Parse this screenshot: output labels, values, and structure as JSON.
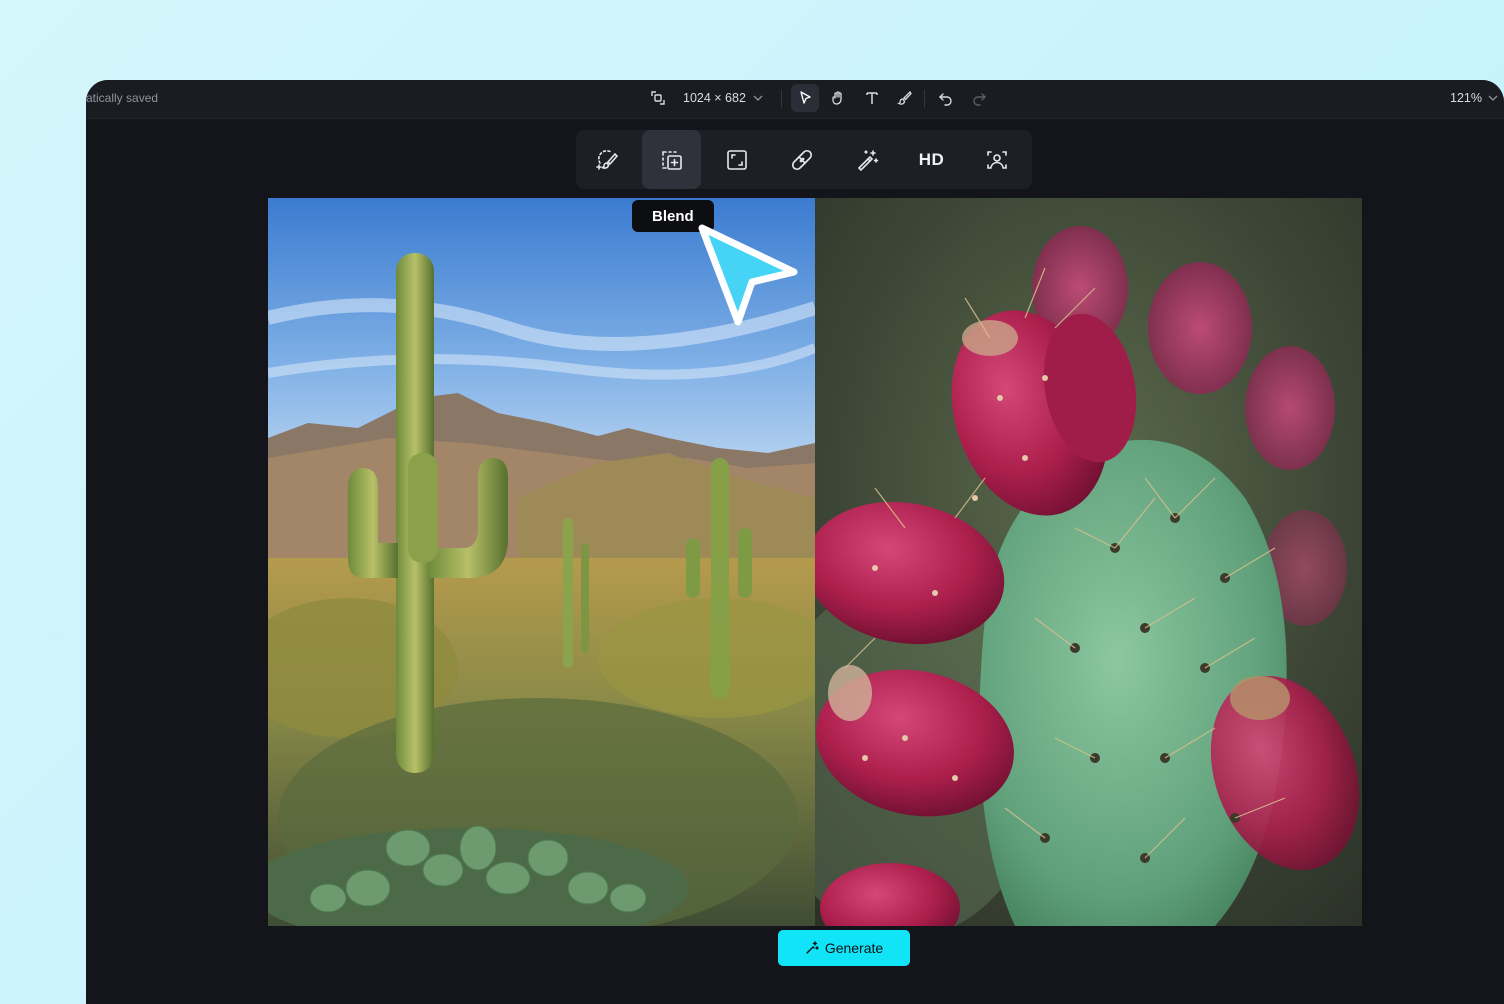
{
  "topbar": {
    "save_status": "atically saved",
    "canvas_size": "1024 × 682",
    "zoom": "121%",
    "icons": [
      "resize-icon",
      "select-arrow-icon",
      "hand-icon",
      "text-icon",
      "brush-icon",
      "undo-icon",
      "redo-icon"
    ]
  },
  "tools": {
    "items": [
      {
        "name": "selection-brush-icon"
      },
      {
        "name": "blend-icon",
        "active": true
      },
      {
        "name": "expand-icon"
      },
      {
        "name": "bandage-icon"
      },
      {
        "name": "magic-wand-icon"
      },
      {
        "name": "hd",
        "label": "HD"
      },
      {
        "name": "portrait-icon"
      }
    ],
    "tooltip": "Blend"
  },
  "images": {
    "left": "saguaro-desert-landscape",
    "right": "prickly-pear-cactus-fruit"
  },
  "actions": {
    "generate_label": "Generate"
  },
  "colors": {
    "accent": "#12e4f7",
    "cursor": "#45d4f5",
    "panel": "#1c1f25",
    "background": "#13151b"
  }
}
